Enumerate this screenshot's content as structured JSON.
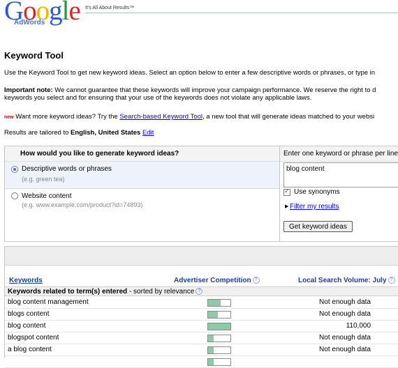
{
  "header": {
    "logo_text": "Google",
    "logo_sub": "AdWords",
    "tagline": "It's All About Results™"
  },
  "title": "Keyword Tool",
  "intro": "Use the Keyword Tool to get new keyword ideas. Select an option below to enter a few descriptive words or phrases, or type in",
  "note_label": "Important note:",
  "note_line1": " We cannot guarantee that these keywords will improve your campaign performance. We reserve the right to d",
  "note_line2": "keywords you select and for ensuring that your use of the keywords does not violate any applicable laws.",
  "new_badge": "new",
  "new_prefix": " Want more keyword ideas? Try the ",
  "new_link": "Search-based Keyword Tool",
  "new_suffix": ", a new tool that will generate ideas matched to your websi",
  "results_prefix": "Results are tailored to ",
  "results_locale": "English, United States",
  "results_edit": "Edit",
  "panel": {
    "question": "How would you like to generate keyword ideas?",
    "enter_label": "Enter one keyword or phrase per line",
    "options": [
      {
        "title": "Descriptive words or phrases",
        "hint": "(e.g. green tea)",
        "selected": true
      },
      {
        "title": "Website content",
        "hint": "(e.g. www.example.com/product?id=74893)",
        "selected": false
      }
    ],
    "keyword_value": "blog content",
    "use_synonyms": "Use synonyms",
    "use_synonyms_checked": true,
    "filter_link": "Filter my results",
    "get_button": "Get keyword ideas"
  },
  "results": {
    "col_keywords": "Keywords",
    "col_competition": "Advertiser Competition",
    "col_volume": "Local Search Volume: July",
    "help_glyph": "?",
    "section_bold": "Keywords related to term(s) entered",
    "section_rest": " - sorted by relevance",
    "rows": [
      {
        "keyword": "blog content management",
        "competition": 0.55,
        "volume": "Not enough data"
      },
      {
        "keyword": "blogs content",
        "competition": 0.45,
        "volume": "Not enough data"
      },
      {
        "keyword": "blog content",
        "competition": 1.0,
        "volume": "110,000"
      },
      {
        "keyword": "blogspot content",
        "competition": 0.25,
        "volume": "Not enough data"
      },
      {
        "keyword": "a blog content",
        "competition": 0.25,
        "volume": "Not enough data"
      },
      {
        "keyword": "",
        "competition": 0.25,
        "volume": ""
      }
    ]
  },
  "colors": {
    "link": "#0000cc",
    "competition_fill": "#8fcaa8",
    "selected_option_bg": "#eef3fb"
  }
}
